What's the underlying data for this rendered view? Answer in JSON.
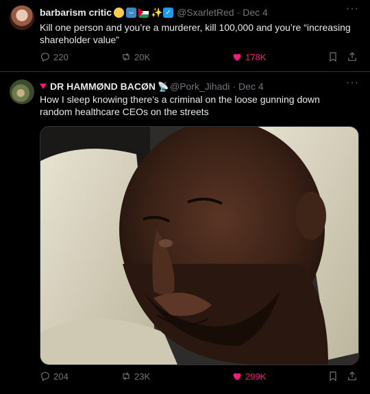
{
  "tweets": [
    {
      "display_name": "barbarism critic",
      "handle": "@SxarletRed",
      "date": "Dec 4",
      "text": "Kill one person and you’re a murderer, kill 100,000 and you’re “increasing shareholder value”",
      "replies": "220",
      "retweets": "20K",
      "likes": "178K",
      "icons": [
        "smiling-face-emoji",
        "left-right-arrow-emoji",
        "palestine-flag-emoji",
        "sparkles-emoji",
        "verified-badge-icon"
      ]
    },
    {
      "display_name": "DR HAMMØND BACØN",
      "handle": "@Pork_Jihadi",
      "date": "Dec 4",
      "text": "How I sleep knowing there's a criminal on the loose gunning down random healthcare CEOs on the streets",
      "replies": "204",
      "retweets": "23K",
      "likes": "299K",
      "icons": [
        "red-triangle-icon",
        "satellite-dish-emoji"
      ]
    }
  ],
  "colors": {
    "background": "#000000",
    "text": "#e7e9ea",
    "muted": "#71767b",
    "like_pink": "#f91880",
    "divider": "#2f3336"
  }
}
